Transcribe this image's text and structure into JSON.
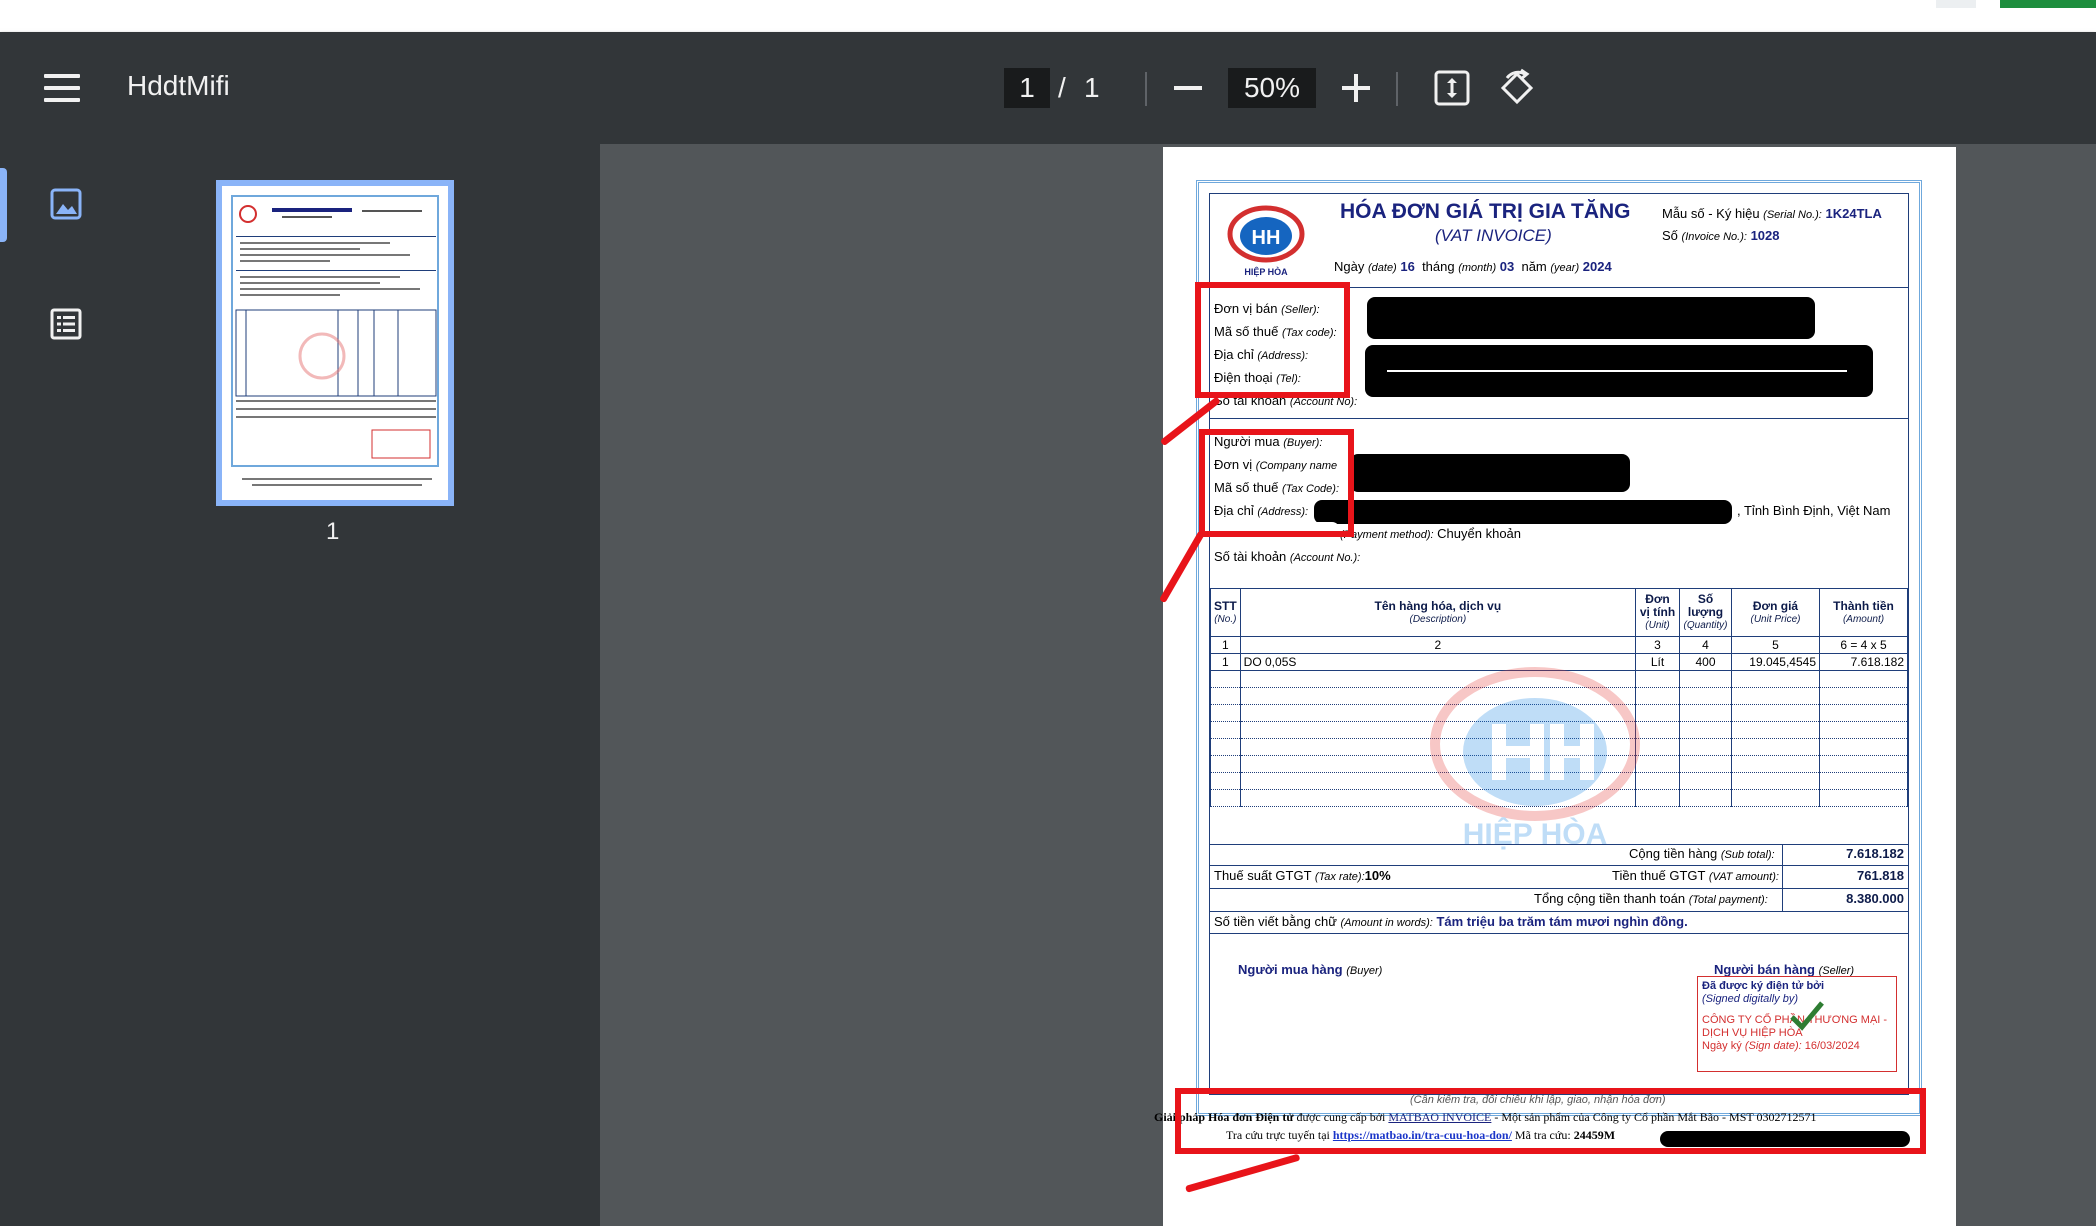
{
  "app": {
    "title": "HddtMifi"
  },
  "toolbar": {
    "current_page": "1",
    "page_separator": "/",
    "total_pages": "1",
    "zoom": "50%"
  },
  "sidebar": {
    "thumbnail_label": "1"
  },
  "invoice": {
    "logo_text": "HIỆP HÒA",
    "logo_initials": "HH",
    "title": "HÓA ĐƠN GIÁ TRỊ GIA TĂNG",
    "subtitle": "(VAT INVOICE)",
    "serial_label": "Mẫu số - Ký hiệu",
    "serial_label_en": "(Serial No.):",
    "serial_value": "1K24TLA",
    "number_label": "Số",
    "number_label_en": "(Invoice No.):",
    "number_value": "1028",
    "date_day_label": "Ngày",
    "date_day_en": "(date)",
    "date_day": "16",
    "date_month_label": "tháng",
    "date_month_en": "(month)",
    "date_month": "03",
    "date_year_label": "năm",
    "date_year_en": "(year)",
    "date_year": "2024",
    "seller_unit_label": "Đơn vị bán",
    "seller_unit_en": "(Seller):",
    "seller_tax_label": "Mã số thuế",
    "seller_tax_en": "(Tax code):",
    "seller_address_label": "Địa chỉ",
    "seller_address_en": "(Address):",
    "seller_phone_label": "Điện thoại",
    "seller_phone_en": "(Tel):",
    "seller_account_label": "Số tài khoản",
    "seller_account_en": "(Account No):",
    "buyer_label": "Người mua",
    "buyer_en": "(Buyer):",
    "buyer_company_label": "Đơn vị",
    "buyer_company_en": "(Company name",
    "buyer_tax_label": "Mã số thuế",
    "buyer_tax_en": "(Tax Code):",
    "buyer_address_label": "Địa chỉ",
    "buyer_address_en": "(Address):",
    "buyer_address_tail": ", Tỉnh Bình Định, Việt Nam",
    "payment_label_en": "(Payment method):",
    "payment_value": "Chuyển khoản",
    "buyer_account_label": "Số tài khoản",
    "buyer_account_en": "(Account No.):",
    "columns": [
      {
        "vi": "STT",
        "en": "(No.)"
      },
      {
        "vi": "Tên hàng hóa, dịch vụ",
        "en": "(Description)"
      },
      {
        "vi": "Đơn vị tính",
        "en": "(Unit)"
      },
      {
        "vi": "Số lượng",
        "en": "(Quantity)"
      },
      {
        "vi": "Đơn giá",
        "en": "(Unit Price)"
      },
      {
        "vi": "Thành tiền",
        "en": "(Amount)"
      }
    ],
    "column_numbers": [
      "1",
      "2",
      "3",
      "4",
      "5",
      "6 = 4 x 5"
    ],
    "rows": [
      {
        "no": "1",
        "desc": "DO 0,05S",
        "unit": "Lít",
        "qty": "400",
        "price": "19.045,4545",
        "amount": "7.618.182"
      }
    ],
    "subtotal_label": "Cộng tiền hàng",
    "subtotal_en": "(Sub total):",
    "subtotal_value": "7.618.182",
    "tax_rate_label": "Thuế suất GTGT",
    "tax_rate_en": "(Tax rate):",
    "tax_rate_value": "10%",
    "vat_amount_label": "Tiền thuế GTGT",
    "vat_amount_en": "(VAT amount):",
    "vat_amount_value": "761.818",
    "total_label": "Tổng cộng tiền thanh toán",
    "total_en": "(Total payment):",
    "total_value": "8.380.000",
    "words_label": "Số tiền viết bằng chữ",
    "words_en": "(Amount in words):",
    "words_value": "Tám triệu ba trăm tám mươi nghìn đồng.",
    "buyer_sign_label": "Người mua hàng",
    "buyer_sign_en": "(Buyer)",
    "seller_sign_label": "Người bán hàng",
    "seller_sign_en": "(Seller)",
    "signed_title": "Đã được ký điện tử bởi",
    "signed_en": "(Signed digitally by)",
    "signed_company": "CÔNG TY CỔ PHẦN THƯƠNG MẠI - DỊCH VỤ HIỆP HÒA",
    "sign_date_label": "Ngày ký",
    "sign_date_en": "(Sign date):",
    "sign_date_value": "16/03/2024",
    "check_note": "(Cần kiểm tra, đối chiếu khi lập, giao, nhận hóa đơn)"
  },
  "footer": {
    "line1_bold": "Giải pháp Hóa đơn Điện tử",
    "line1_mid": "được cung cấp bởi",
    "line1_link": "MATBAO INVOICE",
    "line1_tail": "- Một sản phẩm của Công ty Cổ phần Mắt Bão - MST 0302712571",
    "line2_prefix": "Tra cứu trực tuyến tại",
    "line2_link": "https://matbao.in/tra-cuu-hoa-don/",
    "line2_code_label": "Mã tra cứu:",
    "line2_code_value": "24459M"
  }
}
